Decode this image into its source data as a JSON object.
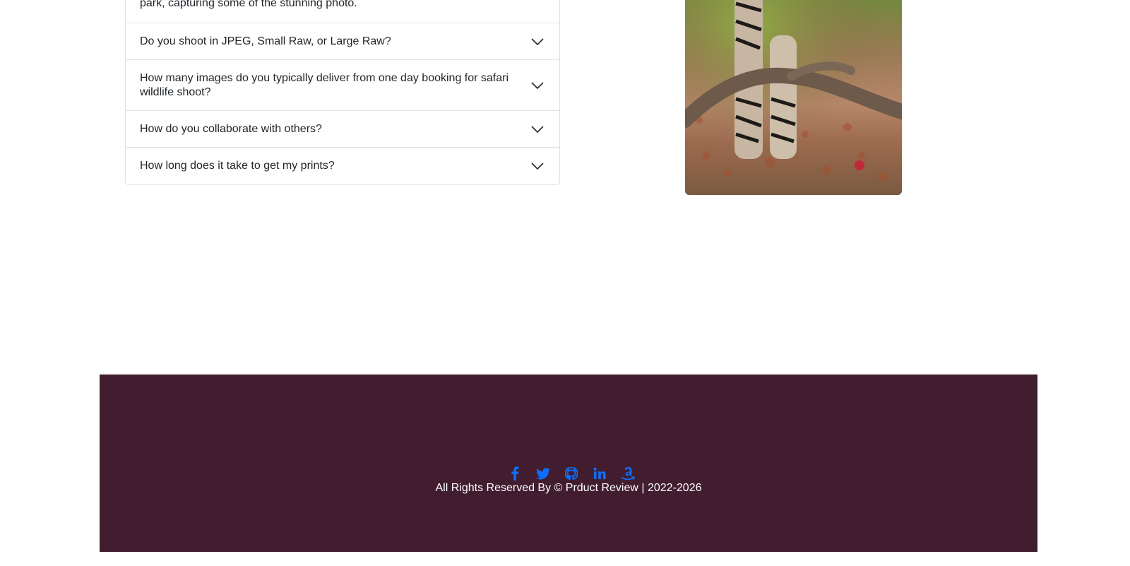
{
  "faq": {
    "open_answer_tail": "park, capturing some of the stunning photo.",
    "items": [
      {
        "question": "Do you shoot in JPEG, Small Raw, or Large Raw?"
      },
      {
        "question": "How many images do you typically deliver from one day booking for safari wildlife shoot?"
      },
      {
        "question": "How do you collaborate with others?"
      },
      {
        "question": "How long does it take to get my prints?"
      }
    ]
  },
  "footer": {
    "social_icons": [
      "facebook-icon",
      "twitter-icon",
      "github-icon",
      "linkedin-icon",
      "amazon-icon"
    ],
    "copyright": "All Rights Reserved By © Prduct Review | 2022-2026",
    "background": "#421d2f",
    "icon_color": "#0d6efd"
  }
}
